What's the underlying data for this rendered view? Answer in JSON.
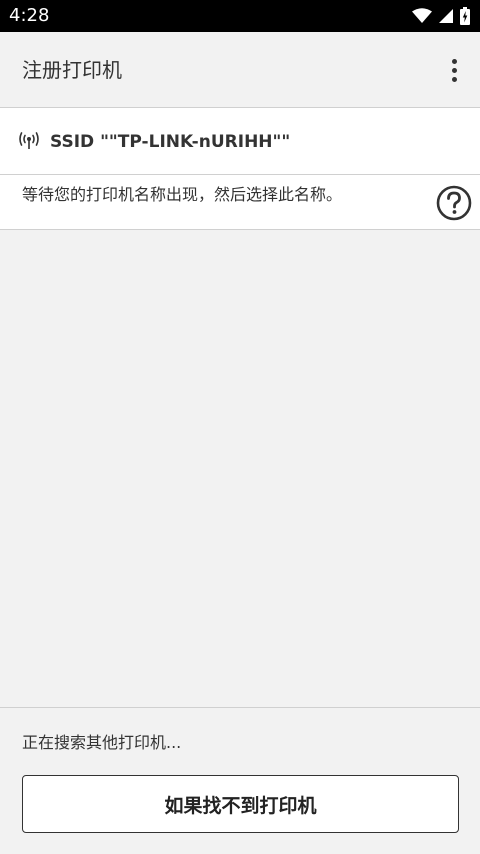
{
  "status_bar": {
    "time": "4:28",
    "icons": [
      "wifi-icon",
      "cell-signal-icon",
      "battery-icon"
    ]
  },
  "app_bar": {
    "title": "注册打印机",
    "menu_icon": "more-vertical-icon"
  },
  "ssid": {
    "icon": "wireless-antenna-icon",
    "label": "SSID \"\"TP-LINK-nURIHH\"\""
  },
  "instruction": {
    "text": "等待您的打印机名称出现，然后选择此名称。",
    "help_icon": "help-circle-icon"
  },
  "printer_list": {
    "items": []
  },
  "bottom": {
    "status_text": "正在搜索其他打印机...",
    "cant_find_button_label": "如果找不到打印机"
  },
  "colors": {
    "background": "#f2f2f2",
    "surface": "#ffffff",
    "text": "#333333",
    "divider": "#d0d0d0",
    "status_bar": "#000000"
  }
}
